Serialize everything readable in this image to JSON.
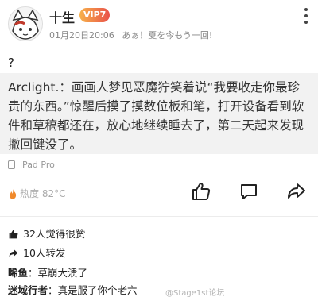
{
  "post": {
    "username": "十生",
    "vip_badge": "VIP7",
    "timestamp": "01月20日20:06",
    "status_text": "あぁ！夏を今もう一回!",
    "question": "?",
    "quote": "Arclight.：画画人梦见恶魔狞笑着说“我要收走你最珍贵的东西。”惊醒后摸了摸数位板和笔，打开设备看到软件和草稿都还在，放心地继续睡去了，第二天起来发现撤回键没了。",
    "device": "iPad Pro",
    "heat": "热度 82°C"
  },
  "stats": {
    "likes": "32人觉得很赞",
    "reposts": "10人转发"
  },
  "comments": [
    {
      "author": "晞鱼",
      "text": "：草崩大溃了"
    },
    {
      "author": "迷域行者",
      "text": "：真是服了你个老六"
    }
  ],
  "watermark": "@Stage1st论坛",
  "colors": {
    "accent": "#f08a2c",
    "quote_bg": "#f2f2f2",
    "muted": "#999999"
  },
  "icons": [
    "avatar-illustration",
    "more-icon",
    "ipad-icon",
    "flame-icon",
    "thumbs-up-icon",
    "comment-icon",
    "repost-icon"
  ]
}
